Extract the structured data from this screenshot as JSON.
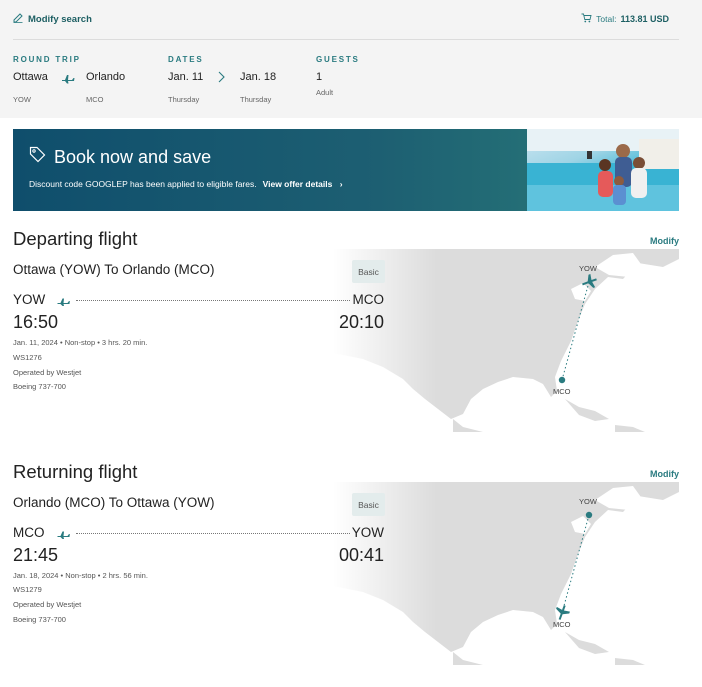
{
  "header": {
    "modify_search": "Modify search",
    "total_label": "Total:",
    "total_value": "113.81 USD"
  },
  "summary": {
    "trip": {
      "heading": "ROUND TRIP",
      "origin_city": "Ottawa",
      "origin_code": "YOW",
      "dest_city": "Orlando",
      "dest_code": "MCO"
    },
    "dates": {
      "heading": "DATES",
      "depart": "Jan. 11",
      "depart_day": "Thursday",
      "return": "Jan. 18",
      "return_day": "Thursday"
    },
    "guests": {
      "heading": "GUESTS",
      "count": "1",
      "type": "Adult"
    }
  },
  "banner": {
    "title": "Book now and save",
    "text": "Discount code GOOGLEP has been applied to eligible fares.",
    "link": "View offer details"
  },
  "departing": {
    "title": "Departing flight",
    "modify": "Modify",
    "route": "Ottawa (YOW) To Orlando (MCO)",
    "fare": "Basic",
    "from_code": "YOW",
    "to_code": "MCO",
    "dep_time": "16:50",
    "arr_time": "20:10",
    "info": "Jan. 11, 2024  •  Non-stop  •  3 hrs. 20 min.",
    "flight_no": "WS1276",
    "operator": "Operated by Westjet",
    "aircraft": "Boeing 737-700",
    "map_top_label": "YOW",
    "map_bottom_label": "MCO"
  },
  "returning": {
    "title": "Returning flight",
    "modify": "Modify",
    "route": "Orlando (MCO) To Ottawa (YOW)",
    "fare": "Basic",
    "from_code": "MCO",
    "to_code": "YOW",
    "dep_time": "21:45",
    "arr_time": "00:41",
    "info": "Jan. 18, 2024  •  Non-stop  •  2 hrs. 56 min.",
    "flight_no": "WS1279",
    "operator": "Operated by Westjet",
    "aircraft": "Boeing 737-700",
    "map_top_label": "YOW",
    "map_bottom_label": "MCO"
  },
  "colors": {
    "accent": "#2a7b80",
    "banner": "#1d5f72",
    "map_land": "#dcdcdc"
  },
  "icons": {
    "edit": "pencil-icon",
    "cart": "cart-icon",
    "tag": "tag-icon",
    "plane": "plane-icon"
  }
}
